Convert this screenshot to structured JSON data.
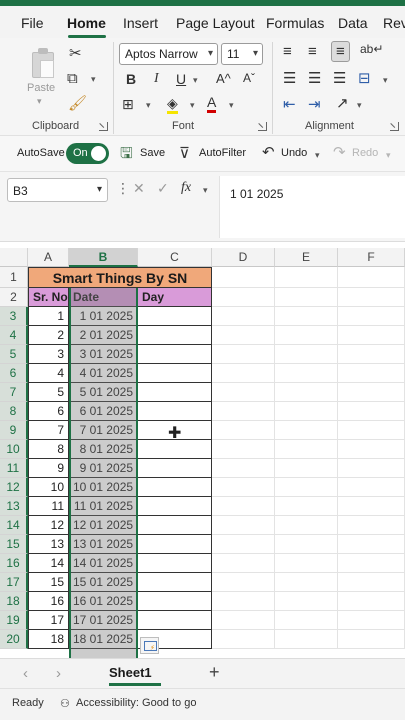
{
  "tabs": [
    "File",
    "Home",
    "Insert",
    "Page Layout",
    "Formulas",
    "Data",
    "Revi"
  ],
  "active_tab": "Home",
  "ribbon": {
    "clipboard": {
      "paste_label": "Paste",
      "group_label": "Clipboard"
    },
    "font": {
      "name": "Aptos Narrow",
      "size": "11",
      "group_label": "Font"
    },
    "alignment": {
      "group_label": "Alignment"
    }
  },
  "quick_access": {
    "autosave_label": "AutoSave",
    "autosave_state": "On",
    "save_label": "Save",
    "autofilter_label": "AutoFilter",
    "undo_label": "Undo",
    "redo_label": "Redo"
  },
  "formula_bar": {
    "name_box": "B3",
    "formula": "1 01 2025"
  },
  "columns": [
    "A",
    "B",
    "C",
    "D",
    "E",
    "F"
  ],
  "selected_column": "B",
  "title": "Smart Things By SN",
  "headers": [
    "Sr. No",
    "Date",
    "Day"
  ],
  "rows": [
    {
      "row": "3",
      "sr": "1",
      "date": "1 01 2025"
    },
    {
      "row": "4",
      "sr": "2",
      "date": "2 01 2025"
    },
    {
      "row": "5",
      "sr": "3",
      "date": "3 01 2025"
    },
    {
      "row": "6",
      "sr": "4",
      "date": "4 01 2025"
    },
    {
      "row": "7",
      "sr": "5",
      "date": "5 01 2025"
    },
    {
      "row": "8",
      "sr": "6",
      "date": "6 01 2025"
    },
    {
      "row": "9",
      "sr": "7",
      "date": "7 01 2025"
    },
    {
      "row": "10",
      "sr": "8",
      "date": "8 01 2025"
    },
    {
      "row": "11",
      "sr": "9",
      "date": "9 01 2025"
    },
    {
      "row": "12",
      "sr": "10",
      "date": "10 01 2025"
    },
    {
      "row": "13",
      "sr": "11",
      "date": "11 01 2025"
    },
    {
      "row": "14",
      "sr": "12",
      "date": "12 01 2025"
    },
    {
      "row": "15",
      "sr": "13",
      "date": "13 01 2025"
    },
    {
      "row": "16",
      "sr": "14",
      "date": "14 01 2025"
    },
    {
      "row": "17",
      "sr": "15",
      "date": "15 01 2025"
    },
    {
      "row": "18",
      "sr": "16",
      "date": "16 01 2025"
    },
    {
      "row": "19",
      "sr": "17",
      "date": "17 01 2025"
    },
    {
      "row": "20",
      "sr": "18",
      "date": "18 01 2025"
    }
  ],
  "sheet_tab": "Sheet1",
  "status": {
    "ready": "Ready",
    "accessibility": "Accessibility: Good to go"
  },
  "colors": {
    "accent": "#1e7145",
    "title_fill": "#f0a87a",
    "header_fill": "#d99bd9"
  }
}
